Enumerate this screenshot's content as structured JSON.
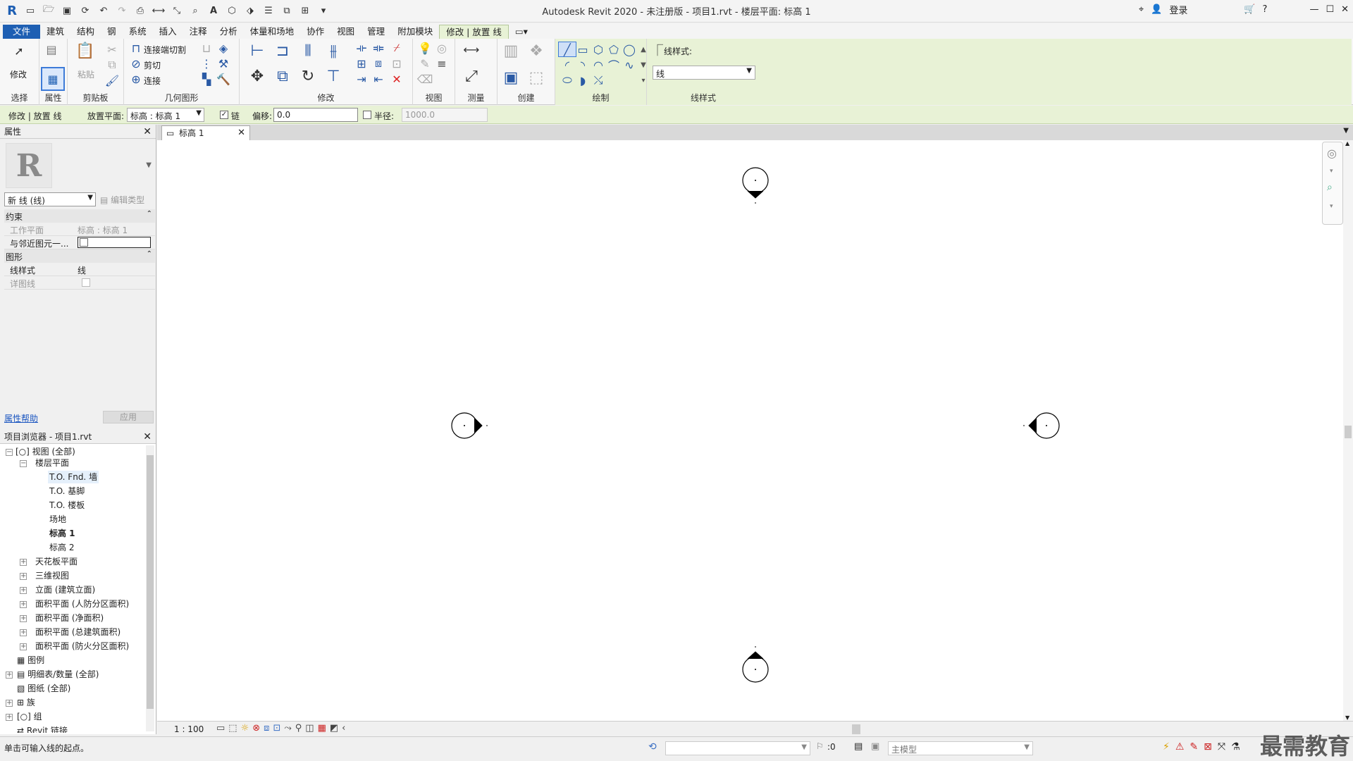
{
  "title": "Autodesk Revit 2020 - 未注册版 - 项目1.rvt - 楼层平面: 标高 1",
  "signin": "登录",
  "menu_tabs": [
    "文件",
    "建筑",
    "结构",
    "钢",
    "系统",
    "插入",
    "注释",
    "分析",
    "体量和场地",
    "协作",
    "视图",
    "管理",
    "附加模块",
    "修改 | 放置 线"
  ],
  "ribbon": {
    "select_label": "选择",
    "modify_label": "修改",
    "properties_label": "属性",
    "clipboard_label": "剪贴板",
    "paste_label": "粘贴",
    "geometry_label": "几何图形",
    "join_cut": "连接端切割",
    "cut": "剪切",
    "join": "连接",
    "modify_panel_label": "修改",
    "view_label": "视图",
    "measure_label": "测量",
    "create_label": "创建",
    "draw_label": "绘制",
    "linestyle_panel_label": "线样式",
    "linestyle_caption": "线样式:",
    "linestyle_value": "线"
  },
  "optbar": {
    "context": "修改 | 放置 线",
    "placement_plane_label": "放置平面:",
    "placement_plane_value": "标高 : 标高 1",
    "chain_label": "链",
    "offset_label": "偏移:",
    "offset_value": "0.0",
    "radius_label": "半径:",
    "radius_value": "1000.0"
  },
  "properties": {
    "title": "属性",
    "type_value": "新 线 (线)",
    "edit_type": "编辑类型",
    "group_constraints": "约束",
    "work_plane_name": "工作平面",
    "work_plane_value": "标高 : 标高 1",
    "nearby_name": "与邻近图元一...",
    "group_graphics": "图形",
    "linestyle_name": "线样式",
    "linestyle_value": "线",
    "detail_name": "详图线",
    "help_link": "属性帮助",
    "apply": "应用"
  },
  "browser": {
    "title": "项目浏览器 - 项目1.rvt",
    "items": [
      {
        "label": "视图 (全部)"
      },
      {
        "label": "楼层平面"
      },
      {
        "label": "T.O. Fnd. 墙"
      },
      {
        "label": "T.O. 基脚"
      },
      {
        "label": "T.O. 楼板"
      },
      {
        "label": "场地"
      },
      {
        "label": "标高 1"
      },
      {
        "label": "标高 2"
      },
      {
        "label": "天花板平面"
      },
      {
        "label": "三维视图"
      },
      {
        "label": "立面 (建筑立面)"
      },
      {
        "label": "面积平面 (人防分区面积)"
      },
      {
        "label": "面积平面 (净面积)"
      },
      {
        "label": "面积平面 (总建筑面积)"
      },
      {
        "label": "面积平面 (防火分区面积)"
      },
      {
        "label": "图例"
      },
      {
        "label": "明细表/数量 (全部)"
      },
      {
        "label": "图纸 (全部)"
      },
      {
        "label": "族"
      },
      {
        "label": "组"
      },
      {
        "label": "Revit 链接"
      }
    ]
  },
  "view_tab": "标高 1",
  "view_scale": "1 : 100",
  "status": {
    "message": "单击可输入线的起点。",
    "zero": ":0",
    "model": "主模型"
  },
  "watermark": "最需教育"
}
